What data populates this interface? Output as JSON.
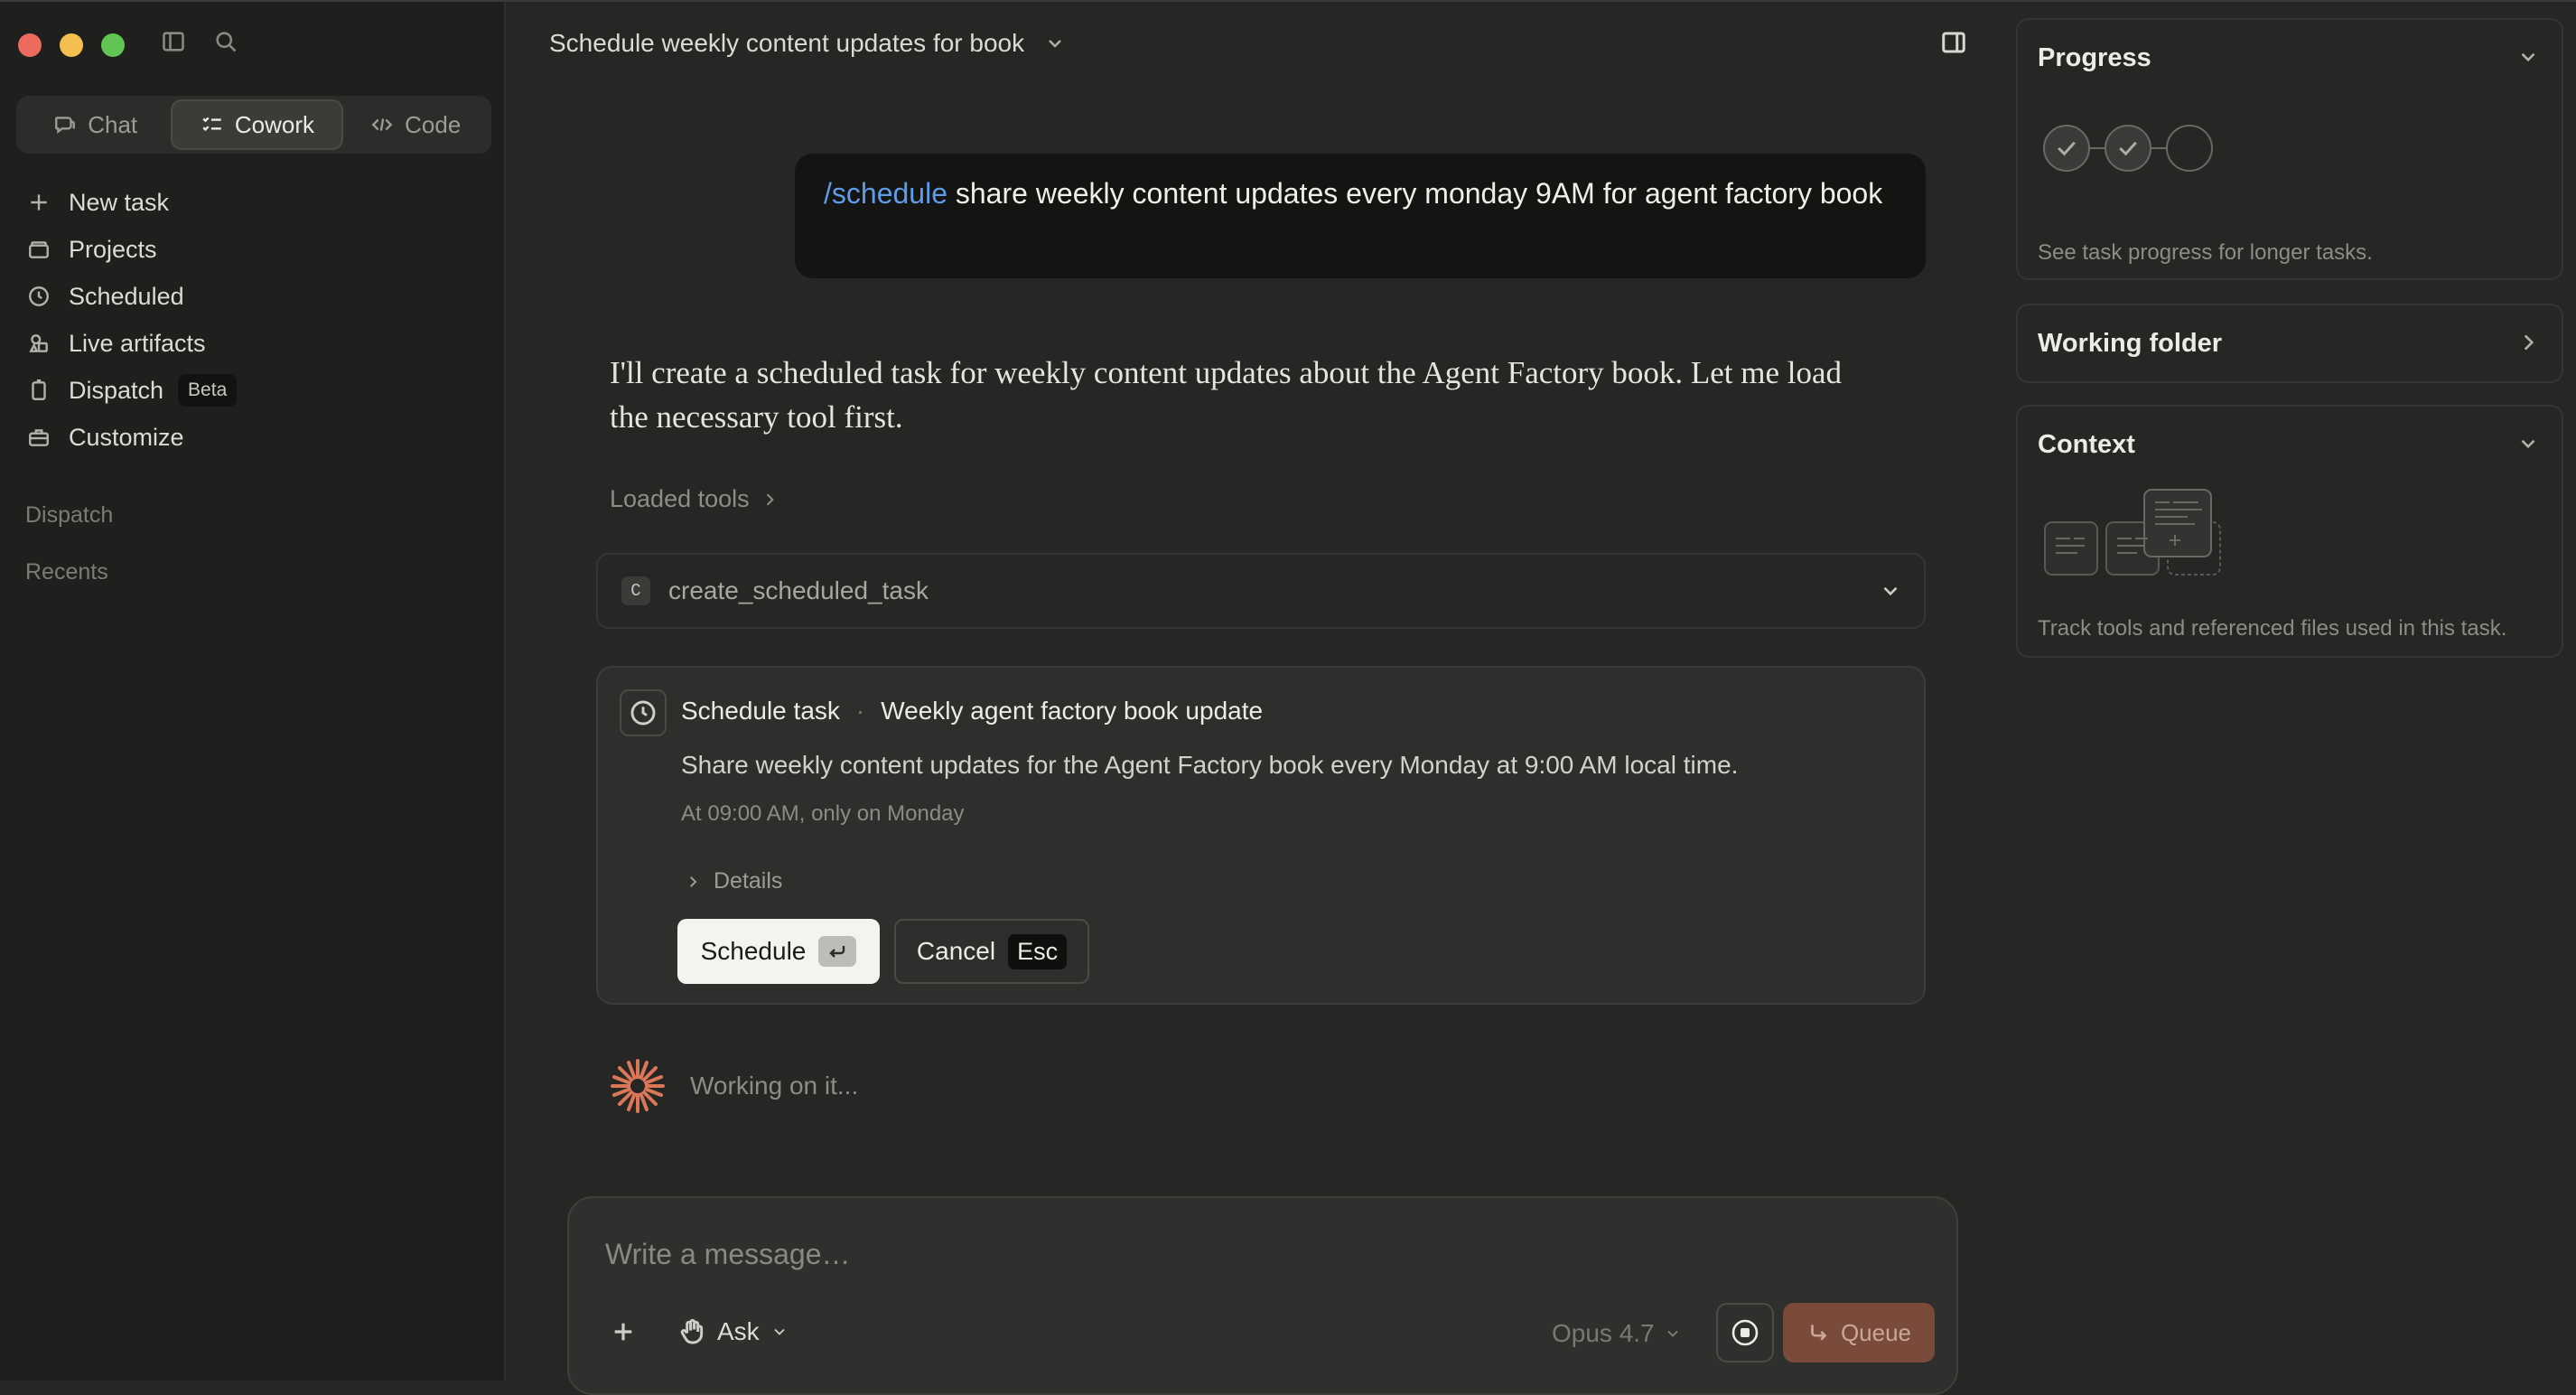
{
  "window": {
    "title": "Schedule weekly content updates for book"
  },
  "sidebar": {
    "modes": [
      {
        "label": "Chat",
        "icon": "chat-bubble-icon"
      },
      {
        "label": "Cowork",
        "icon": "checklist-icon",
        "active": true
      },
      {
        "label": "Code",
        "icon": "code-icon"
      }
    ],
    "nav": [
      {
        "label": "New task",
        "icon": "plus-icon"
      },
      {
        "label": "Projects",
        "icon": "folder-icon"
      },
      {
        "label": "Scheduled",
        "icon": "clock-icon"
      },
      {
        "label": "Live artifacts",
        "icon": "shapes-icon"
      },
      {
        "label": "Dispatch",
        "icon": "phone-icon",
        "badge": "Beta"
      },
      {
        "label": "Customize",
        "icon": "briefcase-icon"
      }
    ],
    "sections": {
      "dispatch": "Dispatch",
      "recents": "Recents"
    }
  },
  "conversation": {
    "user_message": {
      "command": "/schedule",
      "text": " share weekly content updates every monday 9AM for agent factory book"
    },
    "assistant_message": "I'll create a scheduled task for weekly content updates about the Agent Factory book. Let me load the necessary tool first.",
    "loaded_tools_label": "Loaded tools",
    "tool": {
      "badge": "C",
      "name": "create_scheduled_task"
    },
    "schedule_card": {
      "heading": "Schedule task",
      "separator": "·",
      "task_name": "Weekly agent factory book update",
      "description": "Share weekly content updates for the Agent Factory book every Monday at 9:00 AM local time.",
      "when": "At 09:00 AM, only on Monday",
      "details_label": "Details",
      "schedule_button": "Schedule",
      "cancel_button": "Cancel",
      "cancel_key": "Esc"
    },
    "status": "Working on it..."
  },
  "composer": {
    "placeholder": "Write a message…",
    "mode": "Ask",
    "model": "Opus 4.7",
    "queue_button": "Queue"
  },
  "right_panel": {
    "progress": {
      "title": "Progress",
      "steps": [
        {
          "state": "done"
        },
        {
          "state": "done"
        },
        {
          "state": "pending"
        }
      ],
      "note": "See task progress for longer tasks."
    },
    "working_folder": {
      "title": "Working folder"
    },
    "context": {
      "title": "Context",
      "note": "Track tools and referenced files used in this task."
    }
  },
  "colors": {
    "background": "#262624",
    "sidebar": "#1f1f1d",
    "accent_blue": "#5f9ce8",
    "accent_orange": "#d97757",
    "queue_button": "#7a4a3a"
  }
}
